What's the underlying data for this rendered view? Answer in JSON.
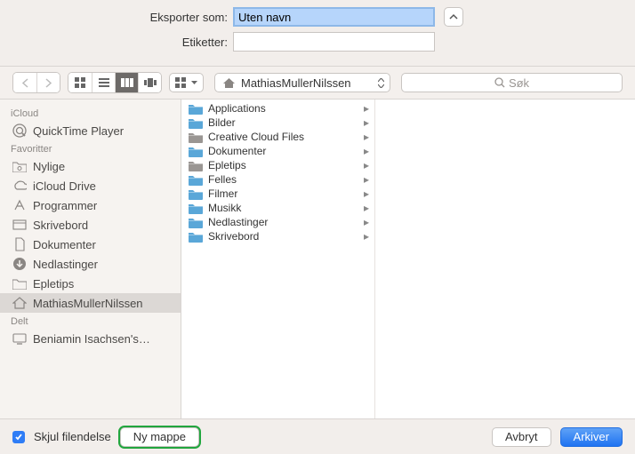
{
  "form": {
    "export_label": "Eksporter som:",
    "export_value": "Uten navn",
    "tags_label": "Etiketter:",
    "tags_value": ""
  },
  "toolbar": {
    "path_label": "MathiasMullerNilssen",
    "search_placeholder": "Søk"
  },
  "sidebar": {
    "sections": [
      {
        "title": "iCloud",
        "items": [
          {
            "label": "QuickTime Player",
            "icon": "qt"
          }
        ]
      },
      {
        "title": "Favoritter",
        "items": [
          {
            "label": "Nylige",
            "icon": "folder-gear"
          },
          {
            "label": "iCloud Drive",
            "icon": "cloud"
          },
          {
            "label": "Programmer",
            "icon": "apps"
          },
          {
            "label": "Skrivebord",
            "icon": "desktop"
          },
          {
            "label": "Dokumenter",
            "icon": "doc"
          },
          {
            "label": "Nedlastinger",
            "icon": "download"
          },
          {
            "label": "Epletips",
            "icon": "folder"
          },
          {
            "label": "MathiasMullerNilssen",
            "icon": "home",
            "selected": true
          }
        ]
      },
      {
        "title": "Delt",
        "items": [
          {
            "label": "Beniamin Isachsen's…",
            "icon": "display"
          }
        ]
      }
    ]
  },
  "columns": [
    {
      "items": [
        {
          "label": "Applications",
          "kind": "folder",
          "color": "blue"
        },
        {
          "label": "Bilder",
          "kind": "folder",
          "color": "blue"
        },
        {
          "label": "Creative Cloud Files",
          "kind": "folder",
          "color": "gray"
        },
        {
          "label": "Dokumenter",
          "kind": "folder",
          "color": "blue"
        },
        {
          "label": "Epletips",
          "kind": "folder",
          "color": "gray"
        },
        {
          "label": "Felles",
          "kind": "folder",
          "color": "blue"
        },
        {
          "label": "Filmer",
          "kind": "folder",
          "color": "blue"
        },
        {
          "label": "Musikk",
          "kind": "folder",
          "color": "blue"
        },
        {
          "label": "Nedlastinger",
          "kind": "folder",
          "color": "blue"
        },
        {
          "label": "Skrivebord",
          "kind": "folder",
          "color": "blue"
        }
      ]
    }
  ],
  "footer": {
    "hide_ext_label": "Skjul filendelse",
    "hide_ext_checked": true,
    "new_folder_label": "Ny mappe",
    "cancel_label": "Avbryt",
    "save_label": "Arkiver"
  }
}
